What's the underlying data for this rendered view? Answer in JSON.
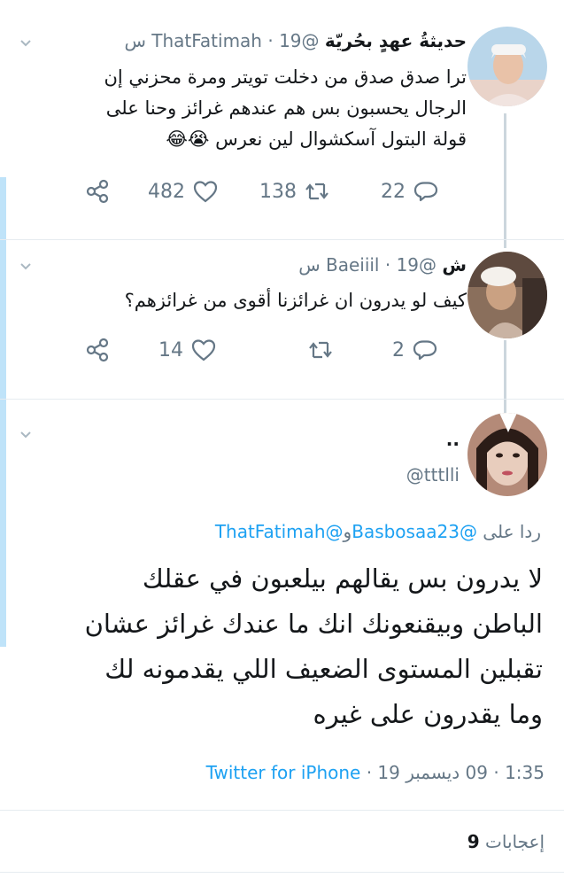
{
  "tweets": [
    {
      "name": "حديثةُ عهدٍ بحُريّة",
      "handle": "@ThatFatimah",
      "time": "19 س",
      "lines": [
        "ترا صدق صدق من دخلت تويتر ومرة محزني إن",
        "الرجال يحسبون بس هم عندهم غرائز وحنا على",
        "قولة البتول آسكشوال لين نعرس 😭😂"
      ],
      "likes": "482",
      "retweets": "138",
      "replies": "22"
    },
    {
      "name": "ش",
      "handle": "@Baeiiil",
      "time": "19 س",
      "lines": [
        "كيف لو يدرون ان غرائزنا أقوى من غرائزهم؟"
      ],
      "likes": "14",
      "retweets": "",
      "replies": "2"
    }
  ],
  "main_tweet": {
    "name": "..",
    "handle": "@tttlli",
    "reply_prefix": "ردا على",
    "reply_to_1": "@Basbosaa23",
    "reply_and": "و",
    "reply_to_2": "@ThatFatimah",
    "lines": [
      "لا يدرون بس يقالهم بيلعبون في عقلك",
      "الباطن وبيقنعونك انك ما عندك غرائز عشان",
      "تقبلين المستوى الضعيف اللي يقدمونه لك",
      "وما يقدرون على غيره"
    ],
    "time": "1:35",
    "date": "09 ديسمبر 19",
    "source": "Twitter for iPhone",
    "likes_count": "9",
    "likes_label": "إعجابات"
  },
  "icons": [
    "chevron-down-icon",
    "share-icon",
    "heart-icon",
    "retweet-icon",
    "reply-icon"
  ]
}
